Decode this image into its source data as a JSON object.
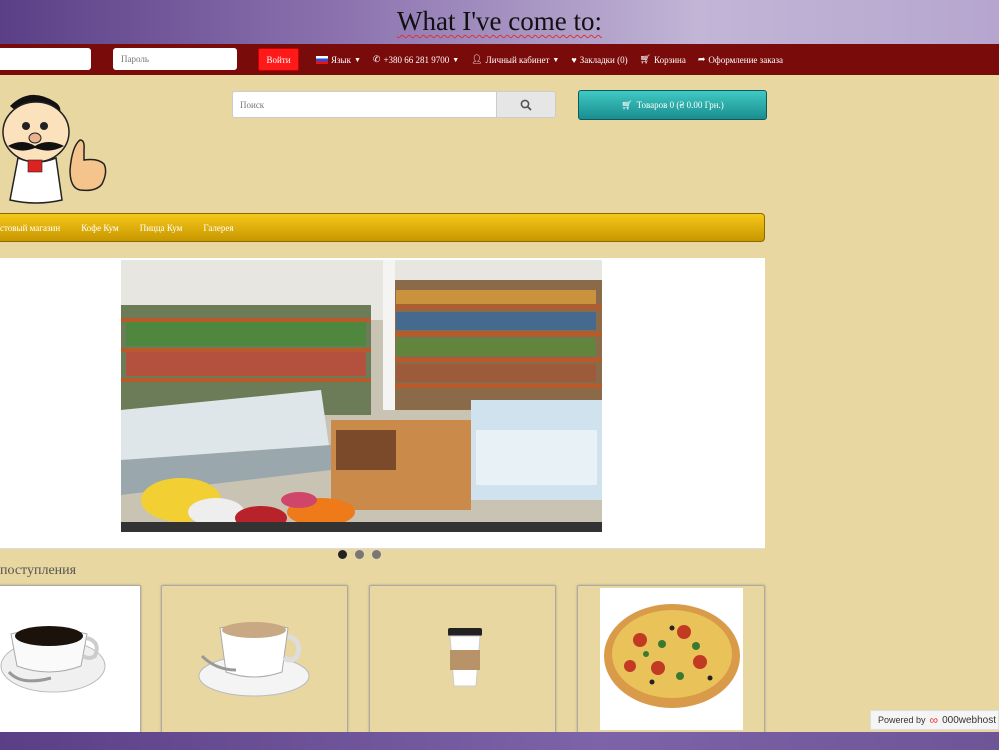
{
  "slide": {
    "title": "What I've come to:"
  },
  "topnav": {
    "password_placeholder": "Пароль",
    "login_label": "Войти",
    "language_label": "Язык",
    "phone": "+380 66 281 9700",
    "account_label": "Личный кабинет",
    "bookmarks_label": "Закладки (0)",
    "cart_label": "Корзина",
    "checkout_label": "Оформление заказа"
  },
  "header": {
    "search_placeholder": "Поиск",
    "cart_button_label": "Товаров 0 (₴ 0.00 Грн.)"
  },
  "menu": {
    "items": [
      "стовый магазин",
      "Кофе Кум",
      "Пицца Кум",
      "Галерея"
    ]
  },
  "slideshow": {
    "dots": 3,
    "active_index": 0
  },
  "products": {
    "section_title": "поступления"
  },
  "hosting_badge": {
    "powered_by": "Powered by",
    "brand": "000webhost"
  },
  "colors": {
    "topnav_bg": "#7a0b0b",
    "page_bg": "#e8d7a0",
    "login_button": "#ff1a1a",
    "cart_button": "#1a8d90",
    "menu_bar": "#e0b000"
  }
}
